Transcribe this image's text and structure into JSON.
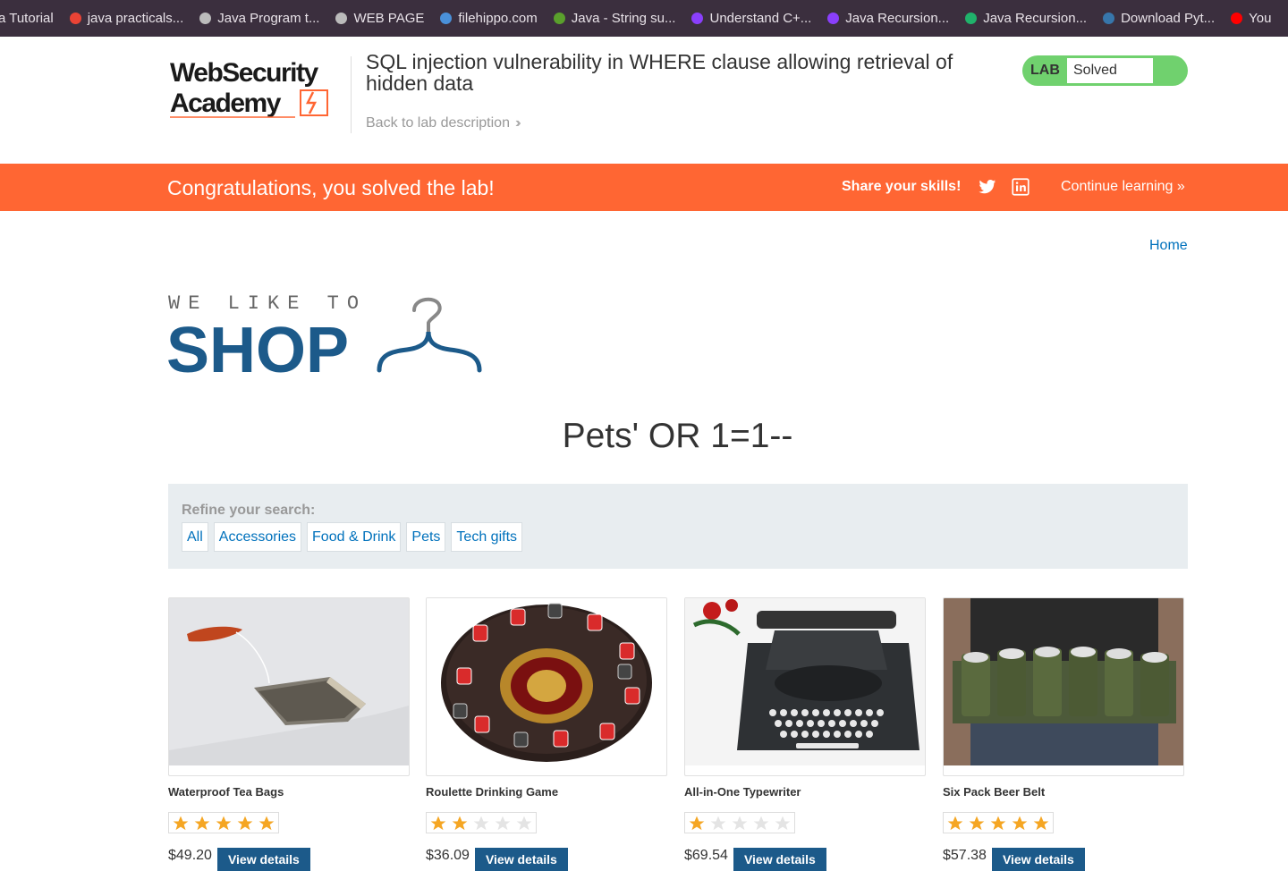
{
  "bookmarks": [
    {
      "label": "a Tutorial",
      "icon": "none",
      "color": ""
    },
    {
      "label": "java practicals...",
      "icon": "gmail-icon",
      "color": "#ea4335"
    },
    {
      "label": "Java Program t...",
      "icon": "globe-icon",
      "color": "#bbbbbb"
    },
    {
      "label": "WEB PAGE",
      "icon": "globe-icon",
      "color": "#bbbbbb"
    },
    {
      "label": "filehippo.com",
      "icon": "filehippo-icon",
      "color": "#4a90d9"
    },
    {
      "label": "Java - String su...",
      "icon": "b-circle-icon",
      "color": "#5aa02c"
    },
    {
      "label": "Understand C+...",
      "icon": "bolt-icon",
      "color": "#8a3ffc"
    },
    {
      "label": "Java Recursion...",
      "icon": "bolt-icon",
      "color": "#8a3ffc"
    },
    {
      "label": "Java Recursion...",
      "icon": "w-icon",
      "color": "#20b26b"
    },
    {
      "label": "Download Pyt...",
      "icon": "python-icon",
      "color": "#3776ab"
    },
    {
      "label": "You",
      "icon": "youtube-icon",
      "color": "#ff0000"
    }
  ],
  "header": {
    "logo_line1": "WebSecurity",
    "logo_line2": "Academy",
    "lab_title": "SQL injection vulnerability in WHERE clause allowing retrieval of hidden data",
    "back_link": "Back to lab description",
    "lab_badge": "LAB",
    "lab_status": "Solved"
  },
  "banner": {
    "congrats": "Congratulations, you solved the lab!",
    "share": "Share your skills!",
    "continue": "Continue learning"
  },
  "nav": {
    "home": "Home"
  },
  "shop_logo": {
    "tagline": "WE LIKE TO",
    "word": "SHOP"
  },
  "search_title": "Pets' OR 1=1--",
  "filter": {
    "refine_label": "Refine your search:",
    "tags": [
      "All",
      "Accessories",
      "Food & Drink",
      "Pets",
      "Tech gifts"
    ]
  },
  "products": [
    {
      "name": "Waterproof Tea Bags",
      "rating": 5,
      "price": "$49.20",
      "button": "View details"
    },
    {
      "name": "Roulette Drinking Game",
      "rating": 2,
      "price": "$36.09",
      "button": "View details"
    },
    {
      "name": "All-in-One Typewriter",
      "rating": 1,
      "price": "$69.54",
      "button": "View details"
    },
    {
      "name": "Six Pack Beer Belt",
      "rating": 5,
      "price": "$57.38",
      "button": "View details"
    }
  ],
  "colors": {
    "accent_orange": "#ff6633",
    "link_blue": "#0071bc",
    "solved_green": "#70d16e",
    "star_gold": "#f5a623"
  }
}
